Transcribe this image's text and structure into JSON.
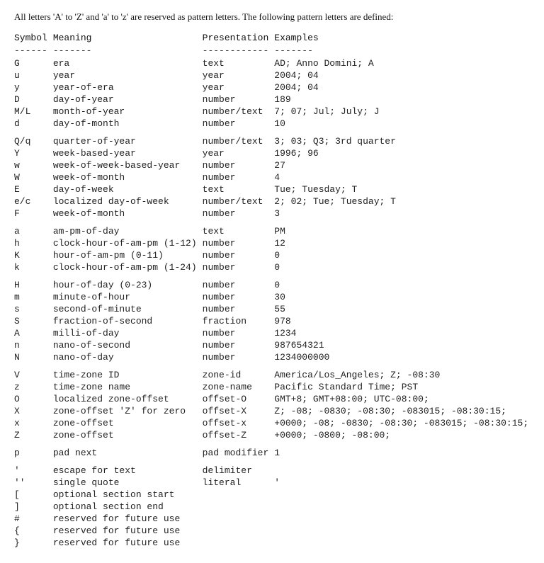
{
  "intro": "All letters 'A' to 'Z' and 'a' to 'z' are reserved as pattern letters. The following pattern letters are defined:",
  "headers": {
    "symbol": "Symbol",
    "meaning": "Meaning",
    "presentation": "Presentation",
    "examples": "Examples"
  },
  "dividers": {
    "symbol": "------",
    "meaning": "-------",
    "presentation": "------------",
    "examples": "-------"
  },
  "rows": [
    {
      "symbol": "G",
      "meaning": "era",
      "presentation": "text",
      "examples": "AD; Anno Domini; A"
    },
    {
      "symbol": "u",
      "meaning": "year",
      "presentation": "year",
      "examples": "2004; 04"
    },
    {
      "symbol": "y",
      "meaning": "year-of-era",
      "presentation": "year",
      "examples": "2004; 04"
    },
    {
      "symbol": "D",
      "meaning": "day-of-year",
      "presentation": "number",
      "examples": "189"
    },
    {
      "symbol": "M/L",
      "meaning": "month-of-year",
      "presentation": "number/text",
      "examples": "7; 07; Jul; July; J"
    },
    {
      "symbol": "d",
      "meaning": "day-of-month",
      "presentation": "number",
      "examples": "10"
    },
    {
      "symbol": "",
      "meaning": "",
      "presentation": "",
      "examples": "",
      "spacer": true
    },
    {
      "symbol": "Q/q",
      "meaning": "quarter-of-year",
      "presentation": "number/text",
      "examples": "3; 03; Q3; 3rd quarter"
    },
    {
      "symbol": "Y",
      "meaning": "week-based-year",
      "presentation": "year",
      "examples": "1996; 96"
    },
    {
      "symbol": "w",
      "meaning": "week-of-week-based-year",
      "presentation": "number",
      "examples": "27"
    },
    {
      "symbol": "W",
      "meaning": "week-of-month",
      "presentation": "number",
      "examples": "4"
    },
    {
      "symbol": "E",
      "meaning": "day-of-week",
      "presentation": "text",
      "examples": "Tue; Tuesday; T"
    },
    {
      "symbol": "e/c",
      "meaning": "localized day-of-week",
      "presentation": "number/text",
      "examples": "2; 02; Tue; Tuesday; T"
    },
    {
      "symbol": "F",
      "meaning": "week-of-month",
      "presentation": "number",
      "examples": "3"
    },
    {
      "symbol": "",
      "meaning": "",
      "presentation": "",
      "examples": "",
      "spacer": true
    },
    {
      "symbol": "a",
      "meaning": "am-pm-of-day",
      "presentation": "text",
      "examples": "PM"
    },
    {
      "symbol": "h",
      "meaning": "clock-hour-of-am-pm (1-12)",
      "presentation": "number",
      "examples": "12"
    },
    {
      "symbol": "K",
      "meaning": "hour-of-am-pm (0-11)",
      "presentation": "number",
      "examples": "0"
    },
    {
      "symbol": "k",
      "meaning": "clock-hour-of-am-pm (1-24)",
      "presentation": "number",
      "examples": "0"
    },
    {
      "symbol": "",
      "meaning": "",
      "presentation": "",
      "examples": "",
      "spacer": true
    },
    {
      "symbol": "H",
      "meaning": "hour-of-day (0-23)",
      "presentation": "number",
      "examples": "0"
    },
    {
      "symbol": "m",
      "meaning": "minute-of-hour",
      "presentation": "number",
      "examples": "30"
    },
    {
      "symbol": "s",
      "meaning": "second-of-minute",
      "presentation": "number",
      "examples": "55"
    },
    {
      "symbol": "S",
      "meaning": "fraction-of-second",
      "presentation": "fraction",
      "examples": "978"
    },
    {
      "symbol": "A",
      "meaning": "milli-of-day",
      "presentation": "number",
      "examples": "1234"
    },
    {
      "symbol": "n",
      "meaning": "nano-of-second",
      "presentation": "number",
      "examples": "987654321"
    },
    {
      "symbol": "N",
      "meaning": "nano-of-day",
      "presentation": "number",
      "examples": "1234000000"
    },
    {
      "symbol": "",
      "meaning": "",
      "presentation": "",
      "examples": "",
      "spacer": true
    },
    {
      "symbol": "V",
      "meaning": "time-zone ID",
      "presentation": "zone-id",
      "examples": "America/Los_Angeles; Z; -08:30"
    },
    {
      "symbol": "z",
      "meaning": "time-zone name",
      "presentation": "zone-name",
      "examples": "Pacific Standard Time; PST"
    },
    {
      "symbol": "O",
      "meaning": "localized zone-offset",
      "presentation": "offset-O",
      "examples": "GMT+8; GMT+08:00; UTC-08:00;"
    },
    {
      "symbol": "X",
      "meaning": "zone-offset 'Z' for zero",
      "presentation": "offset-X",
      "examples": "Z; -08; -0830; -08:30; -083015; -08:30:15;"
    },
    {
      "symbol": "x",
      "meaning": "zone-offset",
      "presentation": "offset-x",
      "examples": "+0000; -08; -0830; -08:30; -083015; -08:30:15;"
    },
    {
      "symbol": "Z",
      "meaning": "zone-offset",
      "presentation": "offset-Z",
      "examples": "+0000; -0800; -08:00;"
    },
    {
      "symbol": "",
      "meaning": "",
      "presentation": "",
      "examples": "",
      "spacer": true
    },
    {
      "symbol": "p",
      "meaning": "pad next",
      "presentation": "pad modifier",
      "examples": "1"
    },
    {
      "symbol": "",
      "meaning": "",
      "presentation": "",
      "examples": "",
      "spacer": true
    },
    {
      "symbol": "'",
      "meaning": "escape for text",
      "presentation": "delimiter",
      "examples": ""
    },
    {
      "symbol": "''",
      "meaning": "single quote",
      "presentation": "literal",
      "examples": "'"
    },
    {
      "symbol": "[",
      "meaning": "optional section start",
      "presentation": "",
      "examples": ""
    },
    {
      "symbol": "]",
      "meaning": "optional section end",
      "presentation": "",
      "examples": ""
    },
    {
      "symbol": "#",
      "meaning": "reserved for future use",
      "presentation": "",
      "examples": ""
    },
    {
      "symbol": "{",
      "meaning": "reserved for future use",
      "presentation": "",
      "examples": ""
    },
    {
      "symbol": "}",
      "meaning": "reserved for future use",
      "presentation": "",
      "examples": ""
    }
  ]
}
